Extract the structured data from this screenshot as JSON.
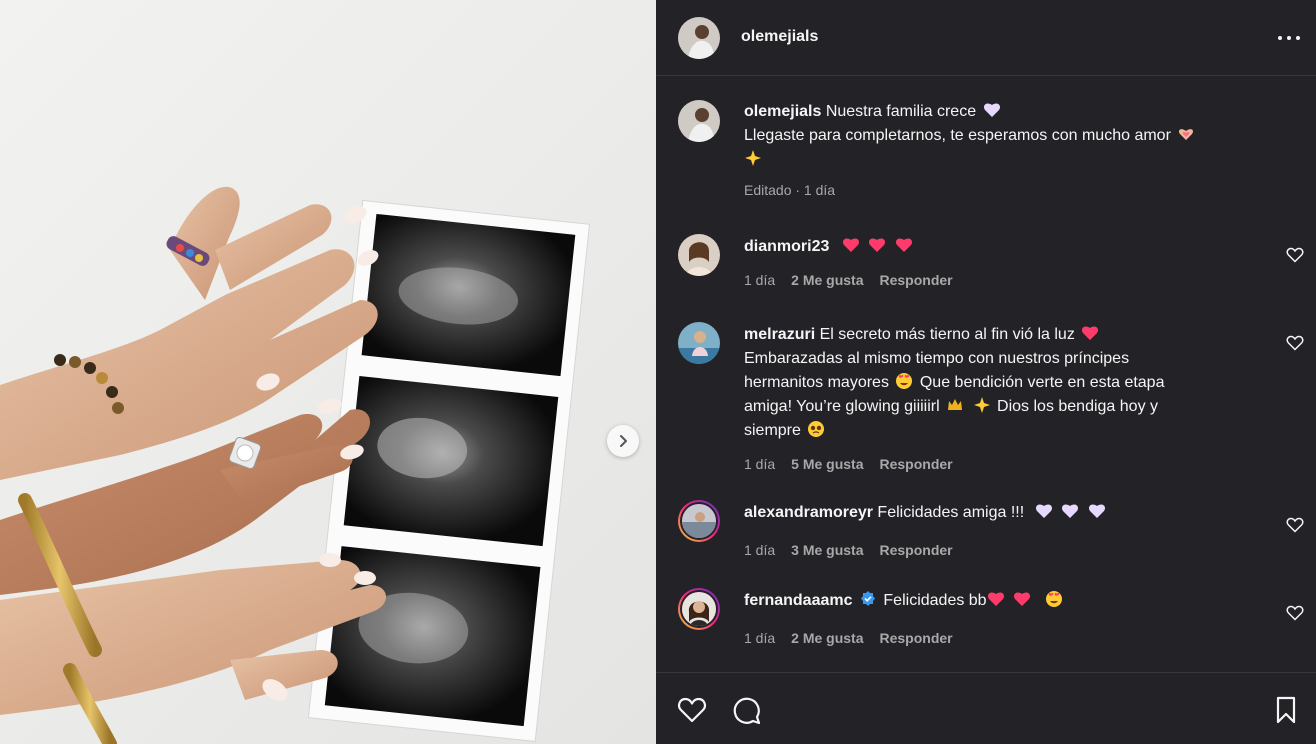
{
  "post": {
    "username": "olemejials",
    "caption_line1": "Nuestra familia crece",
    "caption_line2": "Llegaste para completarnos, te esperamos con mucho amor",
    "caption_meta": "Editado · 1 día"
  },
  "icons": {
    "more": "more-horizontal-icon",
    "next": "chevron-right-icon",
    "like": "heart-outline-icon",
    "comment": "comment-bubble-icon",
    "save": "bookmark-icon",
    "verified": "verified-badge-icon"
  },
  "colors": {
    "panel_bg": "#232327",
    "text": "#f5f5f5",
    "muted": "#a8a8a8",
    "heart_emoji": "#ff3b6b",
    "verified": "#3897f0"
  },
  "comments": [
    {
      "username": "dianmori23",
      "text": "",
      "age": "1 día",
      "likes": "2 Me gusta",
      "reply": "Responder"
    },
    {
      "username": "melrazuri",
      "text_line1": "El secreto más tierno al fin vió la luz",
      "text_line2": "Embarazadas al mismo tiempo con nuestros príncipes",
      "text_line3a": "hermanitos mayores",
      "text_line3b": "Que bendición verte en esta etapa",
      "text_line4a": "amiga! You’re glowing giiiiirl",
      "text_line4b": "Dios los bendiga hoy y",
      "text_line5": "siempre",
      "age": "1 día",
      "likes": "5 Me gusta",
      "reply": "Responder"
    },
    {
      "username": "alexandramoreyr",
      "text": "Felicidades amiga !!!",
      "age": "1 día",
      "likes": "3 Me gusta",
      "reply": "Responder"
    },
    {
      "username": "fernandaaamc",
      "text": "Felicidades bb",
      "age": "1 día",
      "likes": "2 Me gusta",
      "reply": "Responder"
    }
  ]
}
